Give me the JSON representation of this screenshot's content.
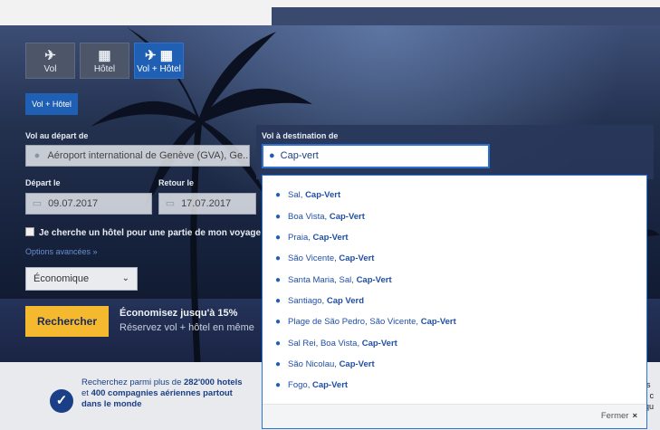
{
  "tabs": [
    {
      "icon": "✈",
      "label": "Vol"
    },
    {
      "icon": "▦",
      "label": "Hôtel"
    },
    {
      "icon": "✈ ▦",
      "label": "Vol + Hôtel"
    }
  ],
  "active_pill": "Vol + Hôtel",
  "departure": {
    "label": "Vol au départ de",
    "value": "Aéroport international de Genève (GVA), Ge..."
  },
  "depart_date": {
    "label": "Départ le",
    "value": "09.07.2017"
  },
  "return_date": {
    "label": "Retour le",
    "value": "17.07.2017"
  },
  "hotel_checkbox": "Je cherche un hôtel pour une partie de mon voyage uni",
  "advanced_options": "Options avancées »",
  "cabin_class": "Économique",
  "search_button": "Rechercher",
  "promo": {
    "title": "Économisez jusqu'à 15%",
    "subtitle": "Réservez vol + hôtel en même"
  },
  "destination": {
    "label": "Vol à destination de",
    "value": "Cap-vert"
  },
  "suggestions": [
    {
      "place": "Sal, ",
      "country": "Cap-Vert"
    },
    {
      "place": "Boa Vista, ",
      "country": "Cap-Vert"
    },
    {
      "place": "Praia, ",
      "country": "Cap-Vert"
    },
    {
      "place": "São Vicente, ",
      "country": "Cap-Vert"
    },
    {
      "place": "Santa Maria, Sal, ",
      "country": "Cap-Vert"
    },
    {
      "place": "Santiago, ",
      "country": "Cap Verd"
    },
    {
      "place": "Plage de São Pedro, São Vicente, ",
      "country": "Cap-Vert"
    },
    {
      "place": "Sal Rei, Boa Vista, ",
      "country": "Cap-Vert"
    },
    {
      "place": "São Nicolau, ",
      "country": "Cap-Vert"
    },
    {
      "place": "Fogo, ",
      "country": "Cap-Vert"
    }
  ],
  "close_label": "Fermer",
  "close_x": "×",
  "bottom": {
    "pre1": "Recherchez parmi plus de ",
    "hotels": "282'000 hotels",
    "pre2": "et ",
    "airlines": "400 compagnies aériennes partout",
    "world": "dans le monde"
  },
  "side_fragments": [
    "is",
    "r c",
    "qu"
  ],
  "colors": {
    "accent": "#1f5fb4",
    "search_button": "#f4b92f",
    "brand_dark": "#1a3f86"
  }
}
